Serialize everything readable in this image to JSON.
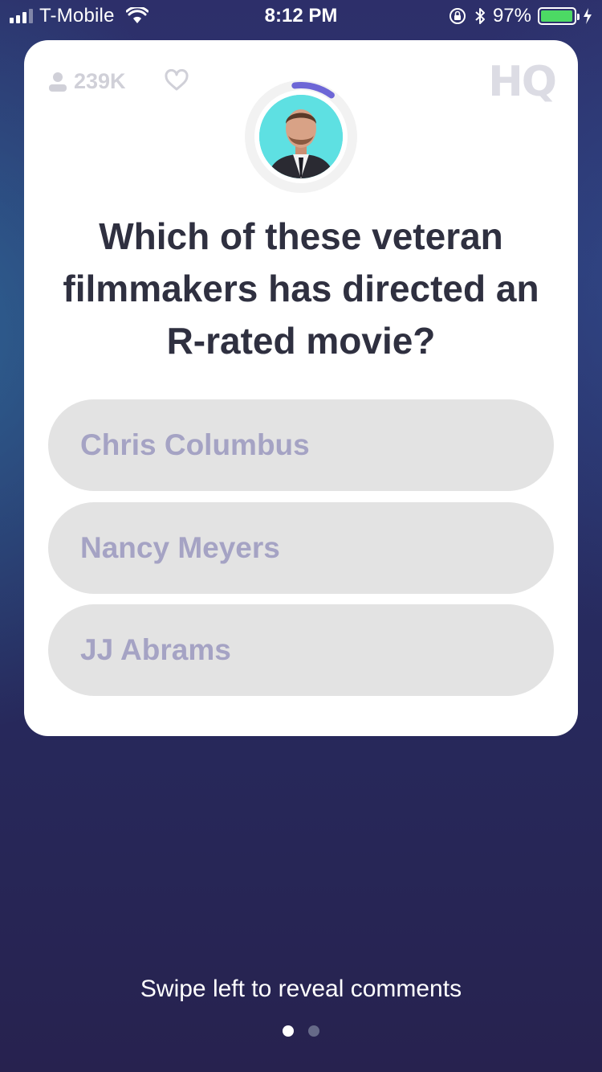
{
  "status_bar": {
    "carrier": "T-Mobile",
    "time": "8:12 PM",
    "battery": "97%",
    "battery_level": 0.97
  },
  "game": {
    "viewer_count": "239K",
    "logo": "HQ",
    "timer_progress": 0.12,
    "question": "Which of these veteran filmmakers has directed an R-rated movie?",
    "answers": [
      {
        "label": "Chris Columbus"
      },
      {
        "label": "Nancy Meyers"
      },
      {
        "label": "JJ Abrams"
      }
    ]
  },
  "footer": {
    "hint": "Swipe left to reveal comments",
    "page_count": 2,
    "active_page": 1
  },
  "colors": {
    "timer_arc": "#6d66d6",
    "answer_bg": "#e3e3e3",
    "answer_text": "#a5a3c4",
    "question_text": "#2f3040",
    "battery_green": "#4cd964"
  },
  "icons": {
    "viewers": "person-icon",
    "like": "heart-icon",
    "wifi": "wifi-icon",
    "rotation_lock": "rotation-lock-icon",
    "bluetooth": "bluetooth-icon",
    "charging": "bolt-icon"
  }
}
